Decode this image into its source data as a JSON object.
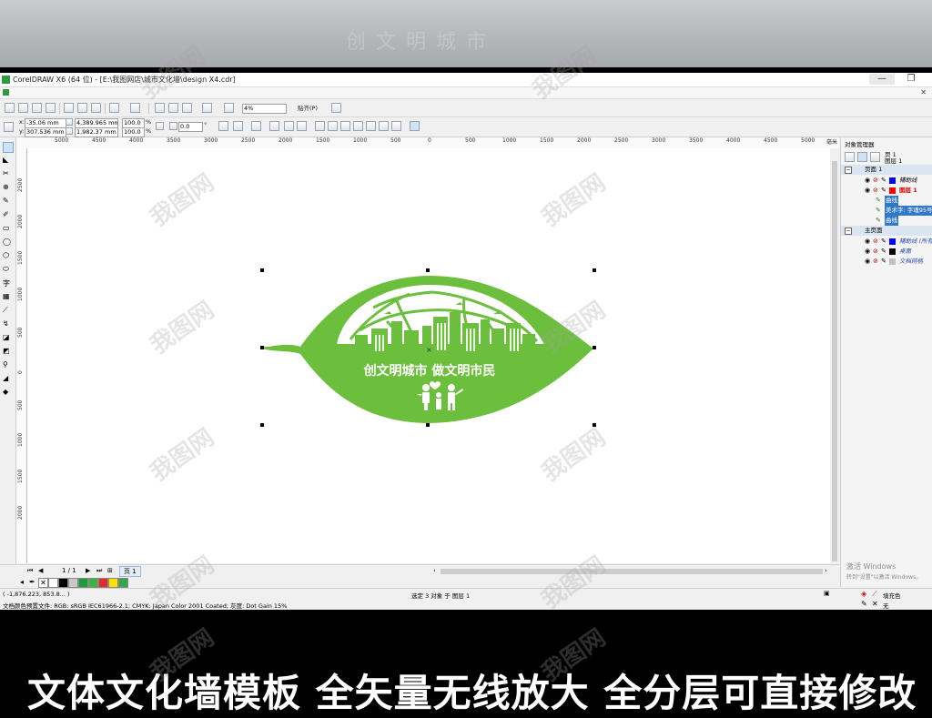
{
  "top_band": {
    "blurred_text": "创 文 明 城 市"
  },
  "window": {
    "title": "CorelDRAW X6 (64 位) - [E:\\我图网店\\城市文化墙\\design X4.cdr]",
    "minimize": "—",
    "restore": "❐",
    "close": "✕"
  },
  "toolbar1": {
    "zoom_value": "4%",
    "snap_label": "贴齐(P)"
  },
  "toolbar2": {
    "x_label": "x:",
    "x_value": "-35.06 mm",
    "y_label": "y:",
    "y_value": "307.536 mm",
    "w_value": "4,389.965 mm",
    "h_value": "1,982.37 mm",
    "scale_x": "100.0",
    "scale_y": "100.0",
    "pct": "%",
    "rotation": "0.0",
    "deg": "°"
  },
  "hruler": [
    "5000",
    "4500",
    "4000",
    "3500",
    "3000",
    "2500",
    "2000",
    "1500",
    "1000",
    "500",
    "0",
    "500",
    "1000",
    "1500",
    "2000",
    "2500",
    "3000",
    "3500",
    "4000",
    "4500",
    "5000"
  ],
  "hruler_unit": "毫米",
  "vruler": [
    "2500",
    "2000",
    "1500",
    "1000",
    "500",
    "0",
    "500",
    "1000",
    "1500",
    "2000"
  ],
  "artwork": {
    "slogan": "创文明城市  做文明市民"
  },
  "page_nav": {
    "page_count": "1 / 1",
    "page_tab": "页 1"
  },
  "status": {
    "coords": "( -1,876.223, 853.8... )",
    "selection": "选定 3 对象 于 图层 1",
    "color_profile": "文档颜色预置文件: RGB: sRGB IEC61966-2.1; CMYK: Japan Color 2001 Coated; 灰度: Dot Gain 15%",
    "fill_label": "填充色",
    "outline_label": "无"
  },
  "palette_colors": [
    "#ffffff",
    "#000000",
    "#c8c8c8",
    "#1a9e3a",
    "#3cb24a",
    "#e52a2a",
    "#ffe100",
    "#2fa84f"
  ],
  "docker": {
    "title": "对象管理器",
    "page_label": "页 1",
    "layer_label": "图层 1",
    "items": [
      {
        "label": "页面 1",
        "kind": "page"
      },
      {
        "label": "辅助线",
        "kind": "layer",
        "color": "#0000ff"
      },
      {
        "label": "图层 1",
        "kind": "layer-active",
        "color": "#ff0000"
      },
      {
        "label": "曲线",
        "kind": "object"
      },
      {
        "label": "美术字: 字魂95号",
        "kind": "object"
      },
      {
        "label": "曲线",
        "kind": "object"
      },
      {
        "label": "主页面",
        "kind": "page"
      },
      {
        "label": "辅助线 (所有",
        "kind": "layer",
        "color": "#0000ff"
      },
      {
        "label": "桌面",
        "kind": "layer",
        "color": "#000000"
      },
      {
        "label": "文档网格",
        "kind": "layer",
        "color": "#c0c0c0"
      }
    ],
    "activate_windows": "激活 Windows",
    "activate_hint": "转到\"设置\"以激活 Windows。"
  },
  "banner": {
    "caption": "文体文化墙模板  全矢量无线放大 全分层可直接修改"
  },
  "watermark": "我图网",
  "colors": {
    "leaf_green": "#6cbf3c",
    "selected_blue": "#3178c6"
  }
}
